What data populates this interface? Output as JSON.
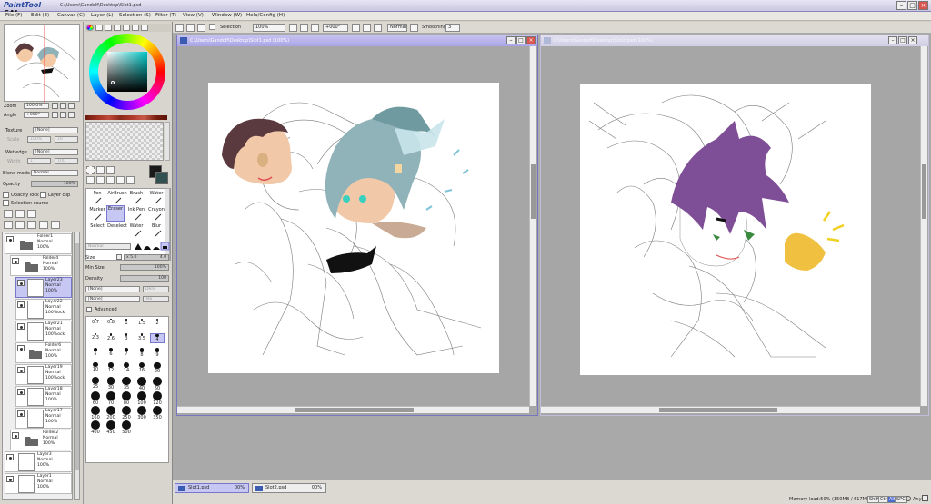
{
  "window": {
    "app_name_a": "PaintTool",
    "app_name_b": "SAI",
    "title_path": "C:\\Users\\Gandolf\\Desktop\\Slot1.psd"
  },
  "menu": [
    "File (F)",
    "Edit (E)",
    "Canvas (C)",
    "Layer (L)",
    "Selection (S)",
    "Filter (T)",
    "View (V)",
    "Window (W)",
    "Help/Config (H)"
  ],
  "toolbar": {
    "selection_label": "Selection",
    "zoom": "100%",
    "angle": "+000°",
    "mode": "Normal",
    "smoothing_label": "Smoothing",
    "smoothing": "3"
  },
  "navigator": {
    "zoom_label": "Zoom",
    "zoom": "100.0%",
    "angle_label": "Angle",
    "angle": "+000°"
  },
  "texture": {
    "label": "Texture",
    "value": "[None]",
    "scale_label": "Scale",
    "scale": "100%",
    "strength": "20"
  },
  "wet_edge": {
    "label": "Wet edge",
    "value": "[None]",
    "width_label": "Width",
    "width": "1",
    "strength": "100"
  },
  "blend": {
    "label": "Blend mode",
    "value": "Normal",
    "opacity_label": "Opacity",
    "opacity": "100%"
  },
  "checks": {
    "opacity_lock": "Opacity lock",
    "layer_clip": "Layer clip",
    "selection_source": "Selection source"
  },
  "layers": [
    {
      "name": "Folder1",
      "mode": "Normal",
      "opacity": "100%",
      "type": "folder",
      "selected": false
    },
    {
      "name": "Folder4",
      "mode": "Normal",
      "opacity": "100%",
      "type": "folder",
      "selected": false
    },
    {
      "name": "Layer23",
      "mode": "Normal",
      "opacity": "100%",
      "type": "layer",
      "selected": true
    },
    {
      "name": "Layer22",
      "mode": "Normal",
      "opacity": "100%ock",
      "type": "layer",
      "selected": false
    },
    {
      "name": "Layer21",
      "mode": "Normal",
      "opacity": "100%ock",
      "type": "layer",
      "selected": false
    },
    {
      "name": "Folder6",
      "mode": "Normal",
      "opacity": "100%",
      "type": "folder",
      "selected": false
    },
    {
      "name": "Layer19",
      "mode": "Normal",
      "opacity": "100%ock",
      "type": "layer",
      "selected": false
    },
    {
      "name": "Layer18",
      "mode": "Normal",
      "opacity": "100%",
      "type": "layer",
      "selected": false
    },
    {
      "name": "Layer17",
      "mode": "Normal",
      "opacity": "100%",
      "type": "layer",
      "selected": false
    },
    {
      "name": "Folder2",
      "mode": "Normal",
      "opacity": "100%",
      "type": "folder",
      "selected": false
    },
    {
      "name": "Layer3",
      "mode": "Normal",
      "opacity": "100%",
      "type": "layer",
      "selected": false
    },
    {
      "name": "Layer1",
      "mode": "Normal",
      "opacity": "100%",
      "type": "layer",
      "selected": false
    }
  ],
  "tools": {
    "row1": [
      "Pen",
      "AirBrush",
      "Brush",
      "Water"
    ],
    "row2": [
      "Marker",
      "Eraser",
      "Ink Pen",
      "Crayon"
    ],
    "row3": [
      "Select",
      "Deselect",
      "Water",
      "Blur"
    ],
    "active": "Eraser"
  },
  "brush_settings": {
    "mode": "Normal",
    "size_label": "Size",
    "size_mult": "x 5.0",
    "size": "4.0",
    "min_size_label": "Min Size",
    "min_size": "100%",
    "density_label": "Density",
    "density": "100",
    "shape1": "[None]",
    "shape1_right": "Dens",
    "shape2": "[None]",
    "shape2_right": "Tex",
    "advanced": "Advanced"
  },
  "brush_sizes": [
    "0.7",
    "0.8",
    "1",
    "1.5",
    "2",
    "2.3",
    "2.6",
    "3",
    "3.5",
    "4",
    "5",
    "6",
    "7",
    "8",
    "9",
    "10",
    "12",
    "14",
    "16",
    "20",
    "25",
    "30",
    "35",
    "40",
    "50",
    "60",
    "70",
    "80",
    "100",
    "120",
    "160",
    "200",
    "250",
    "300",
    "350",
    "400",
    "450",
    "500"
  ],
  "documents": [
    {
      "title": "C:\\Users\\Gandolf\\Desktop\\Slot1.psd (100%)",
      "active": true
    },
    {
      "title": "C:\\Users\\Gandolf\\Desktop\\Slot2.psd (100%)",
      "active": false
    }
  ],
  "tabs": [
    {
      "name": "Slot1.psd",
      "pct": "00%"
    },
    {
      "name": "Slot2.psd",
      "pct": "00%"
    }
  ],
  "status": {
    "memory": "Memory load:50% (150MB / 617MB)",
    "keys": [
      "Shift",
      "Ctrl",
      "Alt",
      "SPC"
    ],
    "any": "Any"
  },
  "colors": {
    "accent": "#7a76c0",
    "selected_layer": "#c7c7f3",
    "canvas_bg": "#a9a9a9"
  }
}
